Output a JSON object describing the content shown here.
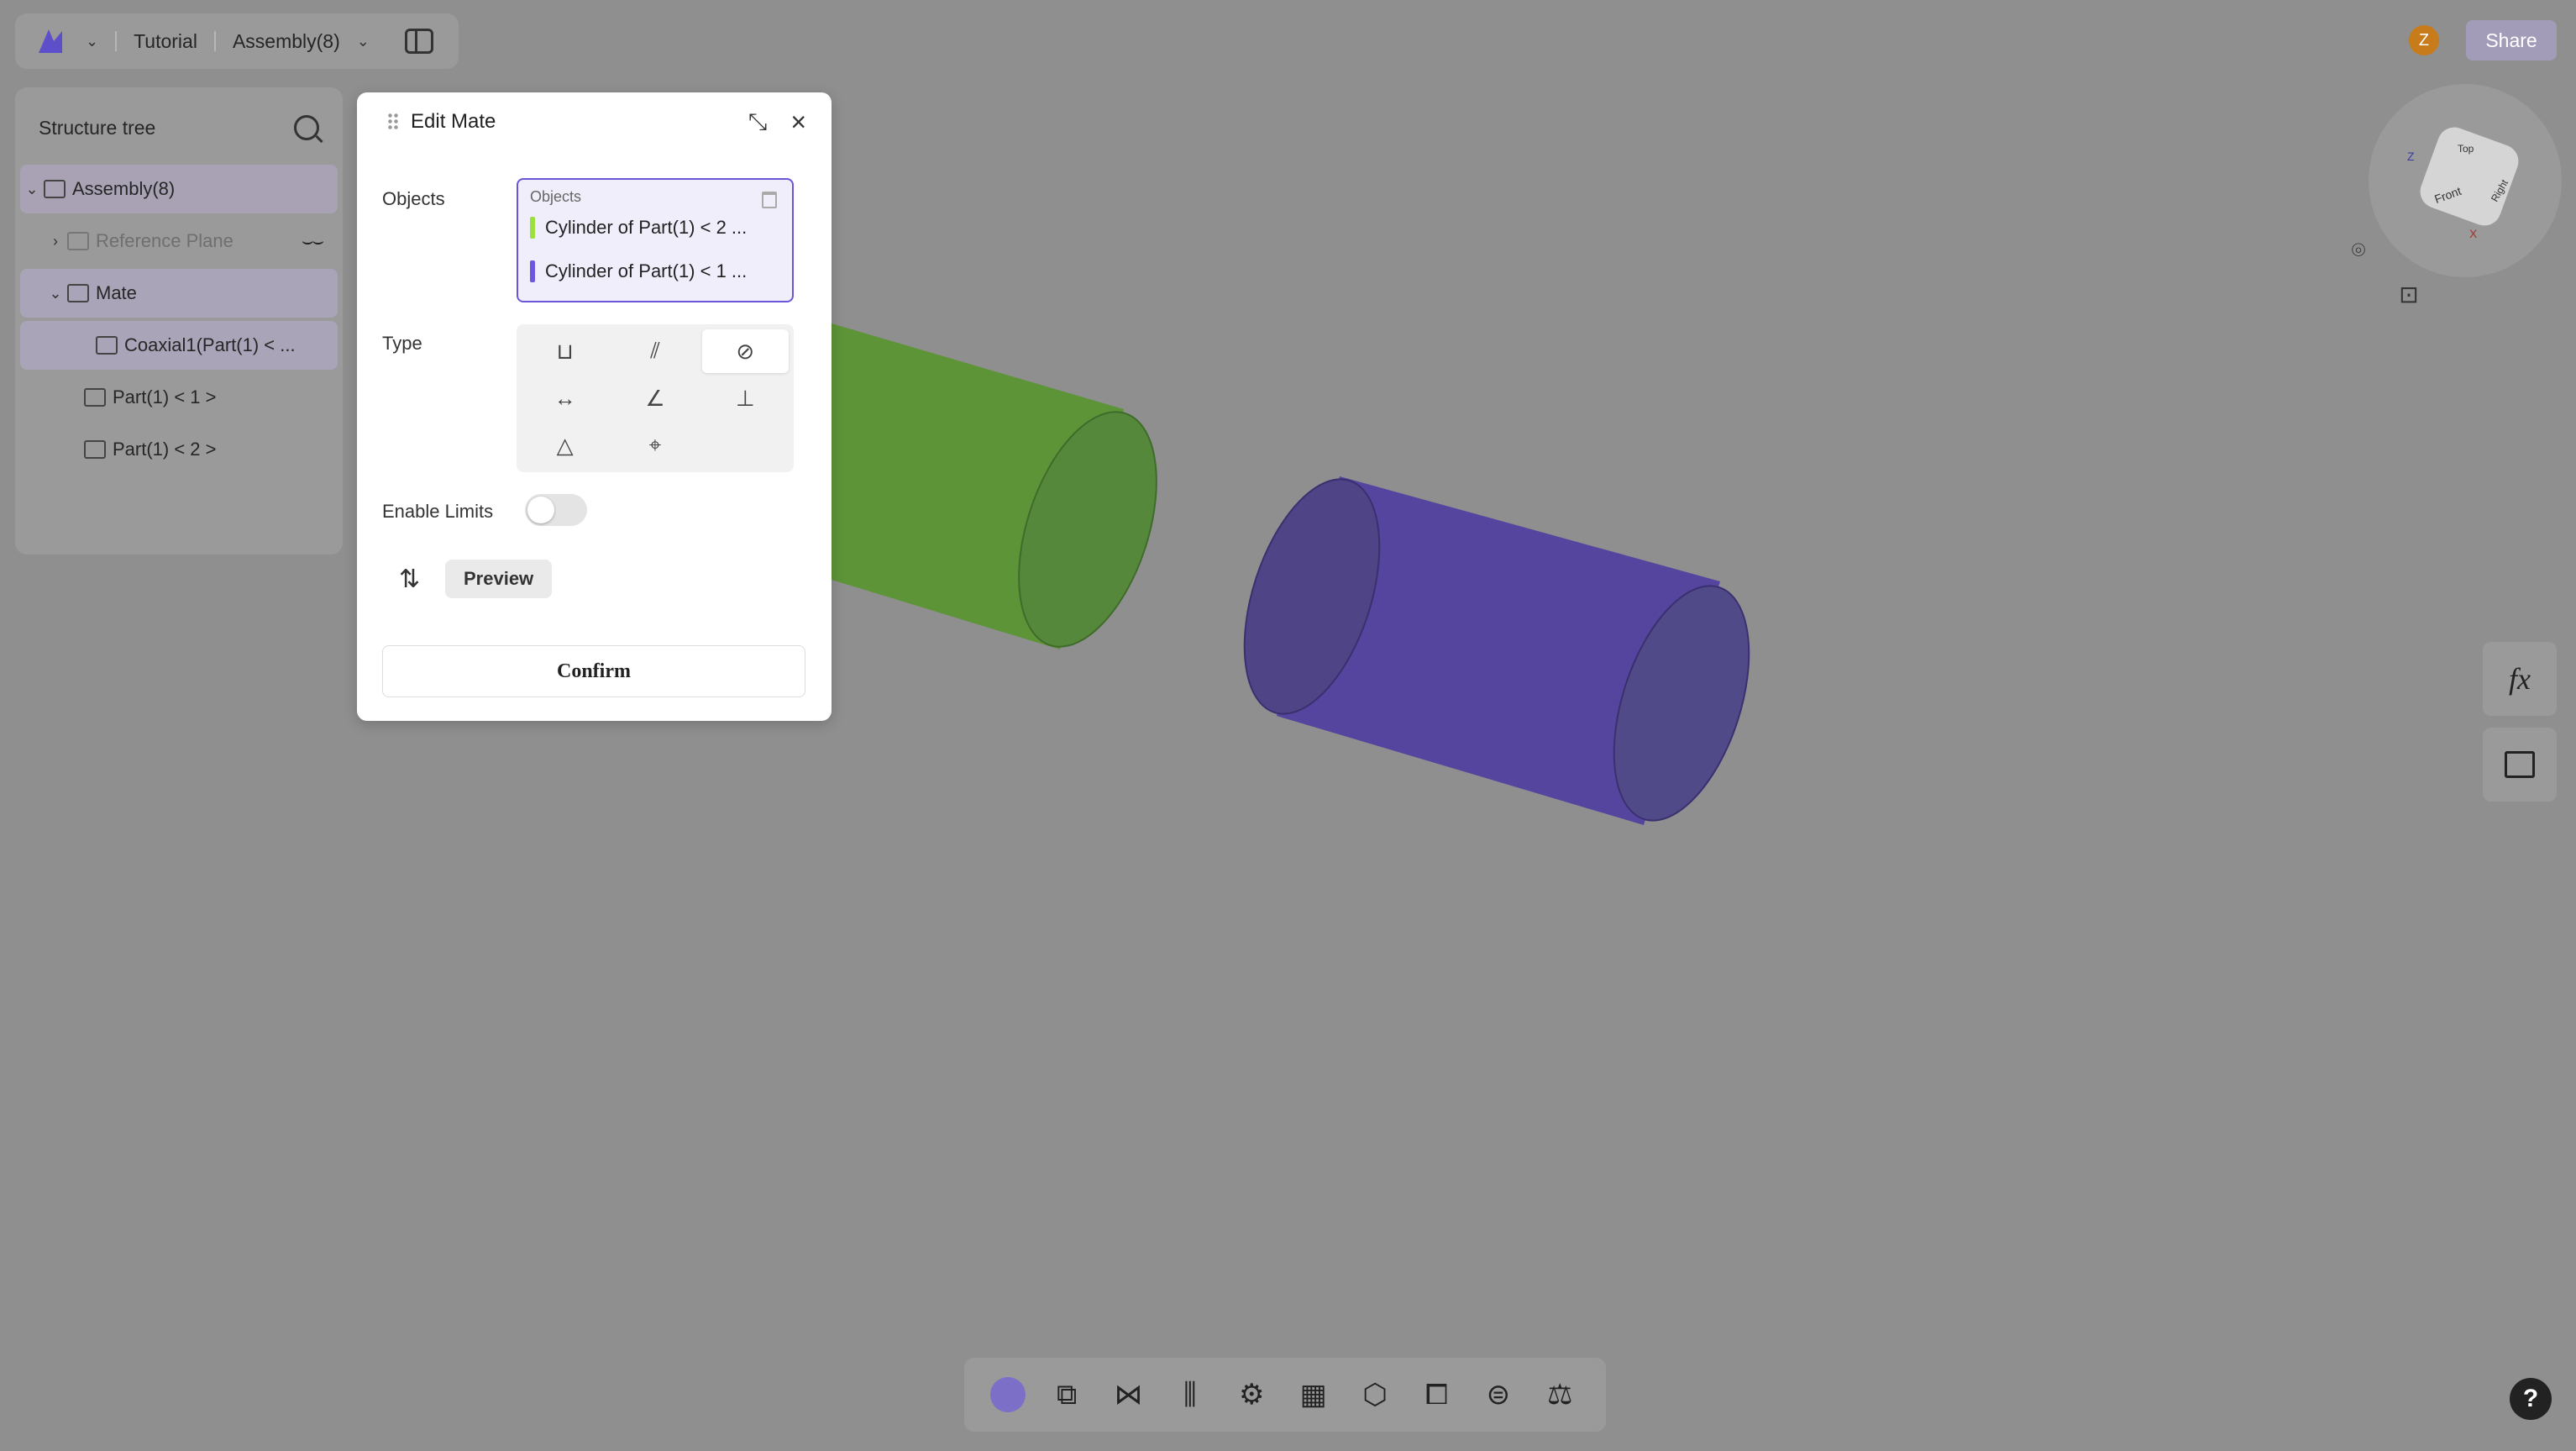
{
  "topbar": {
    "project": "Tutorial",
    "document": "Assembly(8)"
  },
  "tree": {
    "title": "Structure tree",
    "items": [
      {
        "label": "Assembly(8)"
      },
      {
        "label": "Reference Plane"
      },
      {
        "label": "Mate"
      },
      {
        "label": "Coaxial1(Part(1) < ..."
      },
      {
        "label": "Part(1) < 1 >"
      },
      {
        "label": "Part(1) < 2 >"
      }
    ]
  },
  "dialog": {
    "title": "Edit Mate",
    "objects_label": "Objects",
    "objects_box_label": "Objects",
    "objects": [
      {
        "label": "Cylinder of Part(1) < 2 ...",
        "color": "#9be03c"
      },
      {
        "label": "Cylinder of Part(1) < 1 ...",
        "color": "#6e56e0"
      }
    ],
    "type_label": "Type",
    "types": [
      "coincident",
      "parallel",
      "coaxial",
      "distance",
      "angle",
      "perpendicular",
      "tangent",
      "symmetric"
    ],
    "selected_type": "coaxial",
    "enable_limits_label": "Enable Limits",
    "enable_limits": false,
    "preview_label": "Preview",
    "confirm_label": "Confirm"
  },
  "user": {
    "avatar_initial": "Z"
  },
  "share_label": "Share",
  "viewcube": {
    "top": "Top",
    "front": "Front",
    "right": "Right",
    "axis_z": "Z",
    "axis_x": "X"
  },
  "fx_label": "fx",
  "help_label": "?",
  "colors": {
    "green_part": "#5d9437",
    "purple_part": "#55459e",
    "accent": "#6b55d6"
  }
}
